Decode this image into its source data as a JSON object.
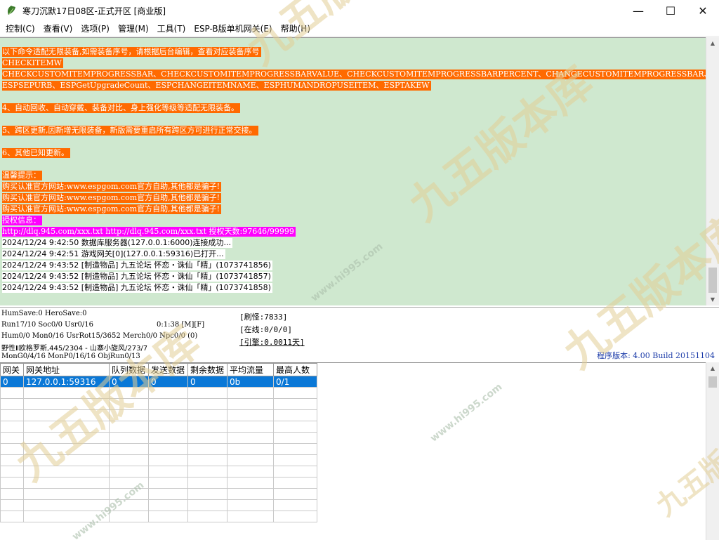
{
  "window": {
    "title": "寒刀沉默17日08区-正式开区 [商业版]",
    "controls": {
      "minimize": "—",
      "maximize": "☐",
      "close": "✕"
    }
  },
  "menu": [
    "控制(C)",
    "查看(V)",
    "选项(P)",
    "管理(M)",
    "工具(T)",
    "ESP-B版单机网关(E)",
    "帮助(H)"
  ],
  "log": {
    "lines": [
      {
        "text": "以下命令适配无限装备,如需装备序号，请根据后台编辑，查看对应装备序号",
        "style": "orange"
      },
      {
        "text": "CHECKITEMW",
        "style": "orange"
      },
      {
        "text": "CHECKCUSTOMITEMPROGRESSBAR、CHECKCUSTOMITEMPROGRESSBARVALUE、CHECKCUSTOMITEMPROGRESSBARPERCENT、CHANGECUSTOMITEMPROGRESSBAR、CHANGECUSTOMITEMPROGRESSBARVALUE",
        "style": "orange"
      },
      {
        "text": "ESPSEPURB、ESPGetUpgradeCount、ESPCHANGEITEMNAME、ESPHUMANDROPUSEITEM、ESPTAKEW",
        "style": "orange"
      },
      {
        "text": "",
        "style": "blank"
      },
      {
        "text": "4、自动回收、自动穿戴、装备对比、身上强化等级等适配无限装备。",
        "style": "orange"
      },
      {
        "text": "",
        "style": "blank"
      },
      {
        "text": "5、跨区更新,因新增无限装备，新版需要重启所有跨区方可进行正常交接。",
        "style": "orange"
      },
      {
        "text": "",
        "style": "blank"
      },
      {
        "text": "6、其他已知更新。",
        "style": "orange"
      },
      {
        "text": "",
        "style": "blank"
      },
      {
        "text": "温馨提示：",
        "style": "orange"
      },
      {
        "text": "购买认准官方网站:www.espgom.com官方自助,其他都是骗子!",
        "style": "orange"
      },
      {
        "text": "购买认准官方网站:www.espgom.com官方自助,其他都是骗子!",
        "style": "orange"
      },
      {
        "text": "购买认准官方网站:www.espgom.com官方自助,其他都是骗子!",
        "style": "orange"
      },
      {
        "text": "授权信息：",
        "style": "magenta"
      },
      {
        "text": "http://dlq.945.com/xxx.txt http://dlq.945.com/xxx.txt 授权天数:97646/99999",
        "style": "magenta"
      },
      {
        "text": "2024/12/24 9:42:50 数据库服务器(127.0.0.1:6000)连接成功...",
        "style": "white"
      },
      {
        "text": "2024/12/24 9:42:51 游戏网关[0](127.0.0.1:59316)已打开...",
        "style": "white"
      },
      {
        "text": "2024/12/24 9:43:52 [制造物品] 九五论坛 怀恋・诛仙「精」(1073741856)",
        "style": "white"
      },
      {
        "text": "2024/12/24 9:43:52 [制造物品] 九五论坛 怀恋・诛仙「精」(1073741857)",
        "style": "white"
      },
      {
        "text": "2024/12/24 9:43:52 [制造物品] 九五论坛 怀恋・诛仙「精」(1073741858)",
        "style": "white"
      }
    ]
  },
  "status": {
    "line1": "HumSave:0 HeroSave:0",
    "line2a": "Run17/10 Soc0/0 Usr0/16",
    "line2b": "0:1:38 [M][F]",
    "line3": "Hum0/0 Mon0/16 UsrRot15/3652 Merch0/0 Npc0/0 (0)",
    "line4": "野性Ⅱ欧格罗斯,445/2304 - 山寨小旋风/273/7",
    "line5": "MonG0/4/16 MonP0/16/16 ObjRun0/13",
    "refresh": "[刷怪:7833]",
    "online": "[在线:0/0/0]",
    "engine": "[引擎:0.0011天]",
    "version": "程序版本: 4.00 Build 20151104"
  },
  "gateway_table": {
    "headers": [
      "网关",
      "网关地址",
      "队列数据",
      "发送数据",
      "剩余数据",
      "平均流量",
      "最高人数"
    ],
    "rows": [
      [
        "0",
        "127.0.0.1:59316",
        "0",
        "0",
        "0",
        "0b",
        "0/1"
      ]
    ]
  },
  "watermark": {
    "text": "九五版本库",
    "url": "www.hi995.com"
  },
  "colors": {
    "log_bg": "#cfe8cf",
    "highlight_orange": "#ff6a00",
    "highlight_magenta": "#ff00ff",
    "selection_blue": "#0a78d7",
    "version_text": "#1a3aa8"
  },
  "icons": {
    "app": "leaf-app-icon",
    "scroll_up": "chevron-up-icon",
    "scroll_down": "chevron-down-icon"
  }
}
